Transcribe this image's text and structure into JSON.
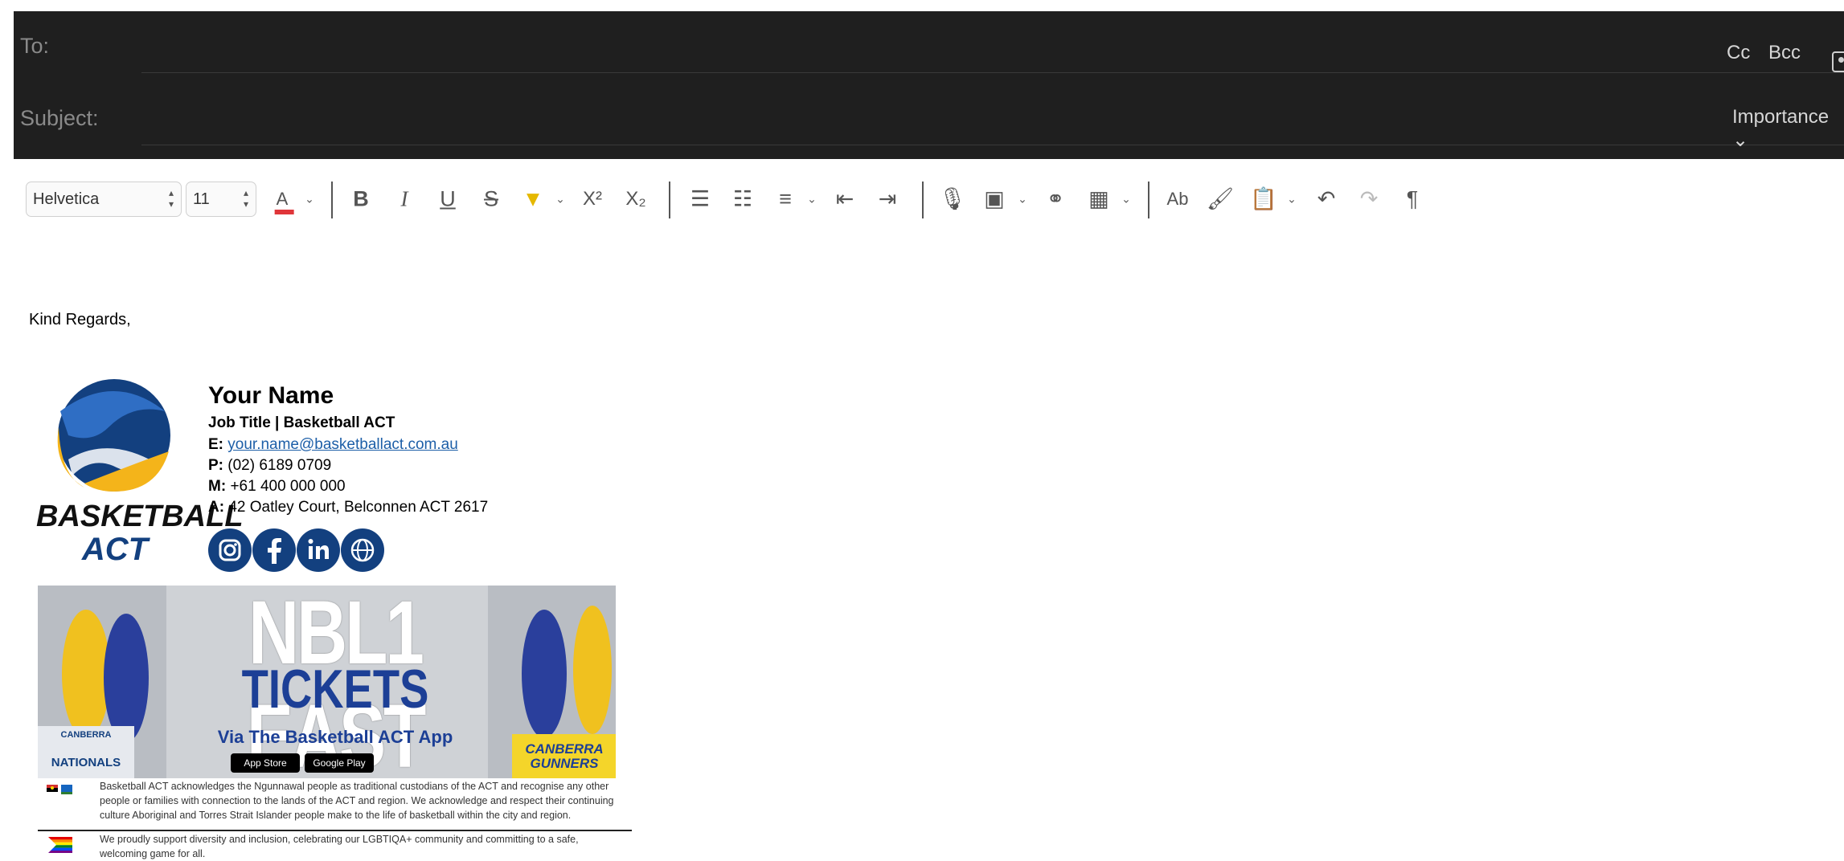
{
  "header": {
    "to_label": "To:",
    "subject_label": "Subject:",
    "cc_label": "Cc",
    "bcc_label": "Bcc",
    "importance_label": "Importance",
    "to_value": "",
    "subject_value": ""
  },
  "toolbar": {
    "font_family": "Helvetica",
    "font_size": "11",
    "text_color": "#e0363a",
    "icons": [
      "font-color-icon",
      "bold-icon",
      "italic-icon",
      "underline-icon",
      "strikethrough-icon",
      "highlight-icon",
      "superscript-icon",
      "subscript-icon",
      "bullet-list-icon",
      "numbered-list-icon",
      "align-icon",
      "decrease-indent-icon",
      "increase-indent-icon",
      "dictate-icon",
      "image-icon",
      "link-icon",
      "table-icon",
      "spelling-icon",
      "format-painter-icon",
      "paste-icon",
      "undo-icon",
      "redo-icon",
      "show-formatting-icon"
    ]
  },
  "message": {
    "greeting": "Kind Regards,"
  },
  "signature": {
    "logo_line1": "BASKETBALL",
    "logo_line2": "ACT",
    "name": "Your Name",
    "job_title": "Job Title | Basketball ACT",
    "email_label": "E:",
    "email": "your.name@basketballact.com.au",
    "phone_label": "P:",
    "phone": "(02) 6189 0709",
    "mobile_label": "M:",
    "mobile": "+61 400 000 000",
    "address_label": "A:",
    "address": "42 Oatley Court, Belconnen ACT 2617",
    "social": [
      "instagram-icon",
      "facebook-icon",
      "linkedin-icon",
      "website-icon"
    ],
    "brand_color": "#13407f",
    "accent_color": "#f4b41a"
  },
  "banner": {
    "headline": "NBL1 EAST",
    "subhead": "TICKETS",
    "tagline": "Via The Basketball ACT App",
    "left_badge_line1": "CANBERRA",
    "left_badge_line2": "NATIONALS",
    "right_badge": "CANBERRA GUNNERS",
    "app_store": "App Store",
    "google_play": "Google Play"
  },
  "footer": {
    "acknowledgement": "Basketball ACT acknowledges the Ngunnawal people as traditional custodians of the ACT and recognise any other people or families with connection to the lands of the ACT and region. We acknowledge and respect their continuing culture Aboriginal and Torres Strait Islander people make to the life of basketball within the city and region.",
    "inclusion": "We proudly support diversity and inclusion, celebrating our LGBTIQA+ community and committing to a safe, welcoming game for all."
  }
}
